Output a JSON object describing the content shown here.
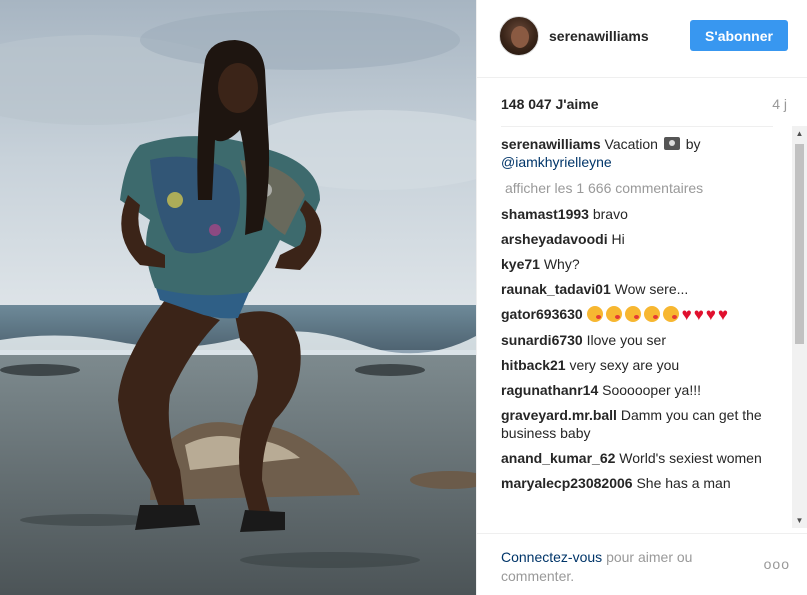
{
  "post": {
    "image_alt": "Photo",
    "header": {
      "username": "serenawilliams",
      "follow_label": "S'abonner"
    },
    "likes": "148 047 J'aime",
    "time": "4 j",
    "caption": {
      "user": "serenawilliams",
      "text_before": "Vacation",
      "text_after": "by",
      "mention": "@iamkhyrielleyne"
    },
    "load_more": "afficher les 1 666 commentaires",
    "comments": [
      {
        "user": "shamast1993",
        "text": "bravo"
      },
      {
        "user": "arsheyadavoodi",
        "text": "Hi"
      },
      {
        "user": "kye71",
        "text": "Why?"
      },
      {
        "user": "raunak_tadavi01",
        "text": "Wow sere..."
      },
      {
        "user": "gator693630",
        "text": ""
      },
      {
        "user": "sunardi6730",
        "text": "Ilove you ser"
      },
      {
        "user": "hitback21",
        "text": "very sexy are you"
      },
      {
        "user": "ragunathanr14",
        "text": "Soooooper ya!!!"
      },
      {
        "user": "graveyard.mr.ball",
        "text": "Damm you can get the business baby"
      },
      {
        "user": "anand_kumar_62",
        "text": "World's sexiest women"
      },
      {
        "user": "maryalecp23082006",
        "text": "She has a man"
      }
    ],
    "footer": {
      "login_link": "Connectez-vous",
      "login_text": "pour aimer ou commenter.",
      "more_options": "ooo"
    }
  },
  "colors": {
    "accent": "#3897f0",
    "link": "#003569",
    "heart": "#e0102e"
  }
}
